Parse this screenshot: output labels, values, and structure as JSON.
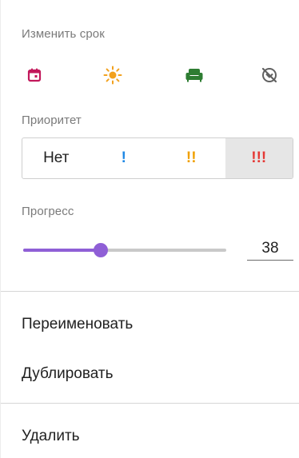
{
  "due_date": {
    "label": "Изменить срок",
    "buttons": [
      {
        "name": "today",
        "icon": "calendar-icon",
        "color": "#c2185b"
      },
      {
        "name": "tomorrow",
        "icon": "sun-icon",
        "color": "#f2a11d"
      },
      {
        "name": "weekend",
        "icon": "couch-icon",
        "color": "#2e7d32"
      },
      {
        "name": "no-date",
        "icon": "no-date-icon",
        "color": "#616161"
      }
    ]
  },
  "priority": {
    "label": "Приоритет",
    "options": [
      {
        "label": "Нет",
        "color": "#212121"
      },
      {
        "label": "!",
        "color": "#1e88e5"
      },
      {
        "label": "!!",
        "color": "#f0a000"
      },
      {
        "label": "!!!",
        "color": "#e53935"
      }
    ],
    "selected_index": 3
  },
  "progress": {
    "label": "Прогресс",
    "value": "38",
    "percent": 38,
    "accent_color": "#8f5fd6"
  },
  "menu_items": {
    "rename": "Переименовать",
    "duplicate": "Дублировать",
    "delete": "Удалить"
  }
}
